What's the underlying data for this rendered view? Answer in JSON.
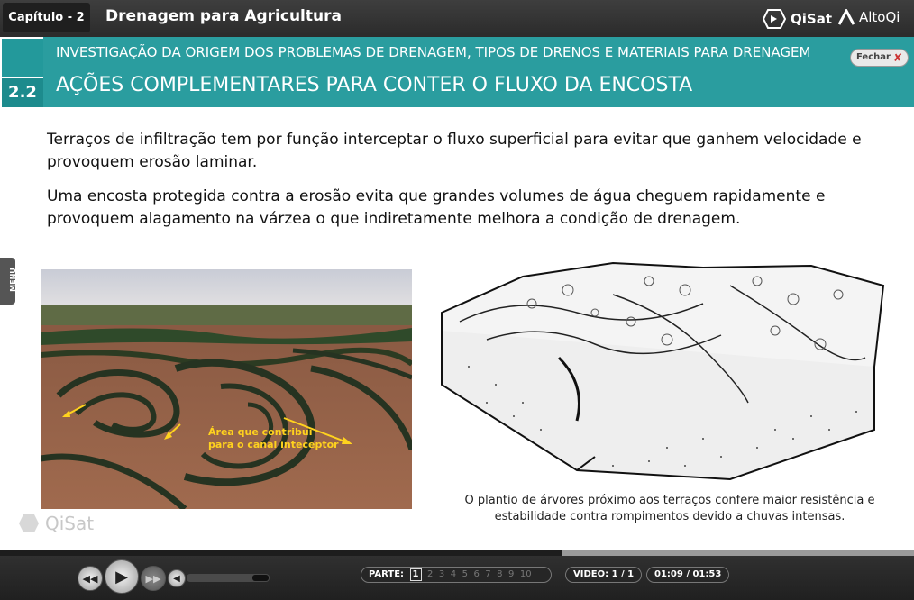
{
  "topbar": {
    "chapter": "Capítulo - 2",
    "course_title": "Drenagem para Agricultura",
    "brand_qisat": "QiSat",
    "brand_altoqi": "AltoQi"
  },
  "section": {
    "number": "2.2",
    "subtitle": "INVESTIGAÇÃO DA ORIGEM DOS PROBLEMAS DE DRENAGEM, TIPOS DE DRENOS E MATERIAIS PARA DRENAGEM",
    "title": "AÇÕES COMPLEMENTARES PARA CONTER O FLUXO DA ENCOSTA",
    "close_label": "Fechar"
  },
  "content": {
    "paragraph1": "Terraços de infiltração tem por função interceptar o fluxo superficial para evitar que ganhem velocidade e provoquem erosão laminar.",
    "paragraph2": "Uma encosta protegida contra a erosão evita que grandes volumes de água cheguem rapidamente e provoquem alagamento na várzea o que indiretamente melhora a condição de drenagem.",
    "photo_caption_line1": "Área que contribui",
    "photo_caption_line2": "para o canal inteceptor",
    "sketch_caption": "O plantio de árvores próximo aos terraços confere maior resistência e estabilidade contra rompimentos devido a chuvas intensas.",
    "menu_label": "MENU",
    "watermark": "QiSat"
  },
  "player": {
    "progress": 0.614,
    "parts_label": "PARTE:",
    "parts": [
      "1",
      "2",
      "3",
      "4",
      "5",
      "6",
      "7",
      "8",
      "9",
      "10"
    ],
    "current_part": "1",
    "video_label": "VIDEO: 1 / 1",
    "time": "01:09 / 01:53",
    "volume": 0.2
  },
  "colors": {
    "teal": "#2a9d9f",
    "accent_yellow": "#ffd21e"
  }
}
